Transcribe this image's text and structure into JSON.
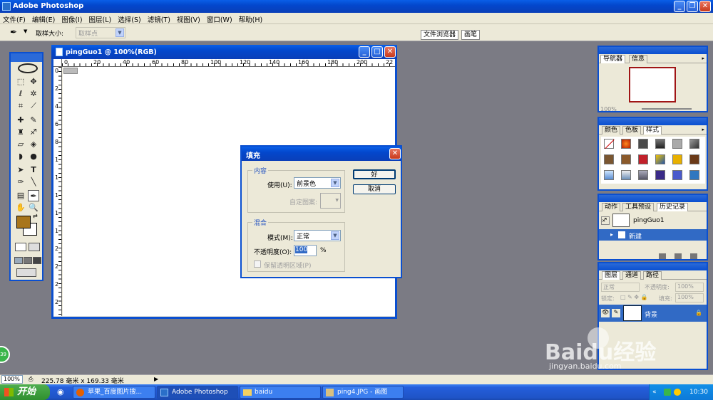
{
  "app": {
    "title": "Adobe Photoshop"
  },
  "menu": [
    "文件(F)",
    "编辑(E)",
    "图像(I)",
    "图层(L)",
    "选择(S)",
    "滤镜(T)",
    "视图(V)",
    "窗口(W)",
    "帮助(H)"
  ],
  "options": {
    "sample_size_label": "取样大小:",
    "sample_size_value": "取样点"
  },
  "palette_well": {
    "file_browser": "文件浏览器",
    "brushes": "画笔"
  },
  "document": {
    "title": "pingGuo1 @ 100%(RGB)",
    "ruler_top": [
      "0",
      "20",
      "40",
      "60",
      "80",
      "100",
      "120",
      "140",
      "160",
      "180",
      "200",
      "22"
    ],
    "ruler_left": [
      "0",
      "2",
      "4",
      "6",
      "8",
      "1",
      "1",
      "1",
      "1",
      "1",
      "2",
      "2",
      "2",
      "2"
    ]
  },
  "dialog": {
    "title": "填充",
    "content_group": "内容",
    "use_label": "使用(U):",
    "use_value": "前景色",
    "custom_pattern_label": "自定图案:",
    "blending_group": "混合",
    "mode_label": "模式(M):",
    "mode_value": "正常",
    "opacity_label": "不透明度(O):",
    "opacity_value": "100",
    "opacity_unit": "%",
    "preserve_label": "保留透明区域(P)",
    "ok": "好",
    "cancel": "取消"
  },
  "navigator": {
    "tabs": [
      "导航器",
      "信息"
    ],
    "zoom": "100%"
  },
  "color_panel": {
    "tabs": [
      "颜色",
      "色板",
      "样式"
    ]
  },
  "history_panel": {
    "tabs": [
      "动作",
      "工具预设",
      "历史记录"
    ],
    "snapshot": "pingGuo1",
    "state": "新建"
  },
  "layers_panel": {
    "tabs": [
      "图层",
      "通道",
      "路径"
    ],
    "blend_mode": "正常",
    "opacity_label": "不透明度:",
    "opacity_value": "100%",
    "lock_label": "锁定:",
    "fill_label": "填充:",
    "fill_value": "100%",
    "layer_name": "背景"
  },
  "status": {
    "zoom": "100%",
    "doc_size": "225.78 毫米 x 169.33 毫米"
  },
  "taskbar": {
    "start": "开始",
    "tasks": [
      "苹果_百度图片搜...",
      "Adobe Photoshop",
      "baidu",
      "ping4.JPG - 画图"
    ],
    "clock": "10:30"
  },
  "watermark": {
    "main": "Baidu经验",
    "url": "jingyan.baidu.com"
  },
  "badge": "39",
  "colors": {
    "foreground": "#a8751b",
    "background": "#ffffff",
    "xp_blue": "#0a4fd0"
  }
}
